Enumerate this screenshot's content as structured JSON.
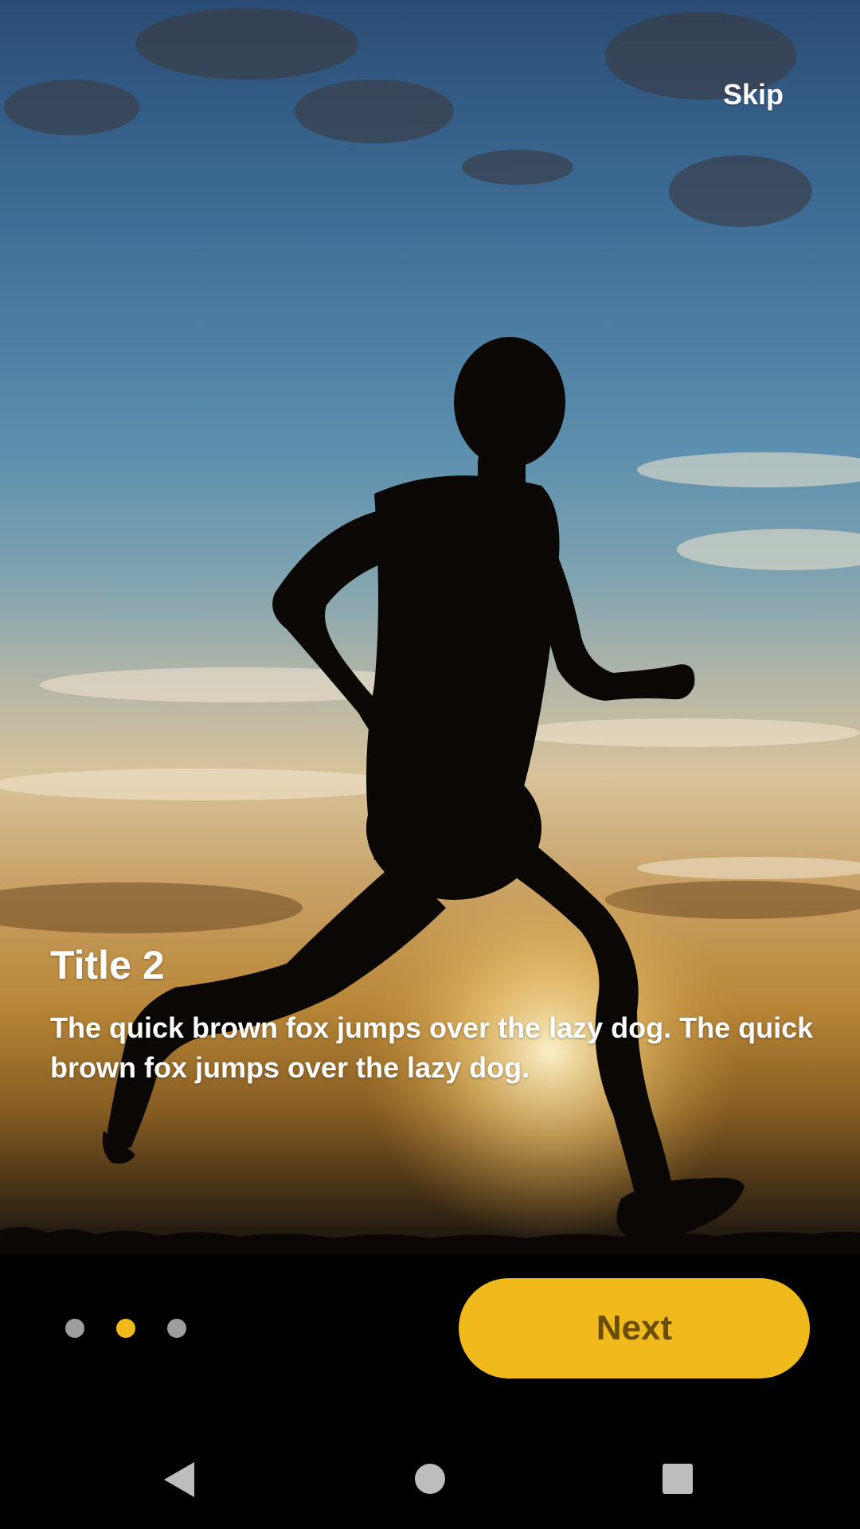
{
  "top_bar": {
    "skip_label": "Skip"
  },
  "slide": {
    "title": "Title 2",
    "description": "The quick brown fox jumps over the lazy dog. The quick brown fox jumps over the lazy dog.",
    "background_image": "runner-silhouette-sunset"
  },
  "pager": {
    "total_pages": 3,
    "active_index": 1,
    "active_color": "#f0b91c",
    "inactive_color": "#9e9e9e"
  },
  "actions": {
    "next_label": "Next",
    "next_color": "#f0b91c",
    "next_text_color": "#6a4d00"
  },
  "system_nav": {
    "back_icon": "back-triangle-icon",
    "home_icon": "home-circle-icon",
    "recents_icon": "recents-square-icon"
  }
}
